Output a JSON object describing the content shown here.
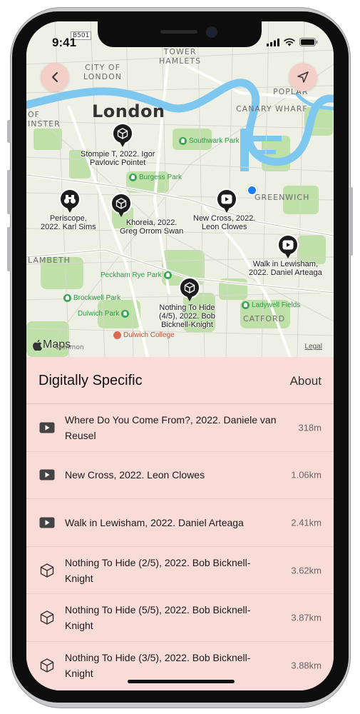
{
  "status_bar": {
    "time": "9:41"
  },
  "map": {
    "labels": {
      "tower_hamlets": "TOWER\nHAMLETS",
      "city_of_london": "CITY OF\nLONDON",
      "london": "London",
      "poplar": "POPLAR",
      "canary_wharf": "CANARY WHARF",
      "westminster": "OF\nINSTER",
      "greenwich": "GREENWICH",
      "lambeth": "LAMBETH",
      "catford": "CATFORD",
      "b501": "B501",
      "common": "Common"
    },
    "parks": {
      "southwark_park": "Southwark Park",
      "burgess_park": "Burgess Park",
      "peckham_rye_park": "Peckham Rye Park",
      "brockwell_park": "Brockwell Park",
      "dulwich_park": "Dulwich Park",
      "ladywell_fields": "Ladywell Fields"
    },
    "poi": {
      "dulwich_college": "Dulwich College"
    },
    "pins": [
      {
        "label": "Stompie T, 2022. Igor\nPavlovic Pointet",
        "icon": "cube-icon"
      },
      {
        "label": "Periscope,\n2022. Karl Sims",
        "icon": "binoculars-icon"
      },
      {
        "label": "Khoreia, 2022.\nGreg Orrom Swan",
        "icon": "cube-icon"
      },
      {
        "label": "New Cross, 2022.\nLeon Clowes",
        "icon": "play-icon"
      },
      {
        "label": "Walk in Lewisham,\n2022. Daniel Arteaga",
        "icon": "play-icon"
      },
      {
        "label": "Nothing To Hide\n(4/5), 2022. Bob\nBicknell-Knight",
        "icon": "cube-icon"
      }
    ],
    "attribution": "Maps",
    "legal": "Legal"
  },
  "sheet": {
    "title": "Digitally Specific",
    "about": "About",
    "items": [
      {
        "title": "Where Do You Come From?, 2022. Daniele van Reusel",
        "distance": "318m",
        "icon": "video-icon"
      },
      {
        "title": "New Cross, 2022. Leon Clowes",
        "distance": "1.06km",
        "icon": "video-icon"
      },
      {
        "title": "Walk in Lewisham, 2022. Daniel Arteaga",
        "distance": "2.41km",
        "icon": "video-icon"
      },
      {
        "title": "Nothing To Hide (2/5), 2022. Bob Bicknell-Knight",
        "distance": "3.62km",
        "icon": "cube-icon"
      },
      {
        "title": "Nothing To Hide (5/5), 2022. Bob Bicknell-Knight",
        "distance": "3.87km",
        "icon": "cube-icon"
      },
      {
        "title": "Nothing To Hide (3/5), 2022. Bob Bicknell-Knight",
        "distance": "3.88km",
        "icon": "cube-icon"
      }
    ]
  },
  "colors": {
    "sheet_bg": "#f9dcd7",
    "button_bg": "#f4cfc7",
    "river": "#7ec8ef",
    "park": "#b9dca2",
    "location": "#1a7ff0"
  }
}
